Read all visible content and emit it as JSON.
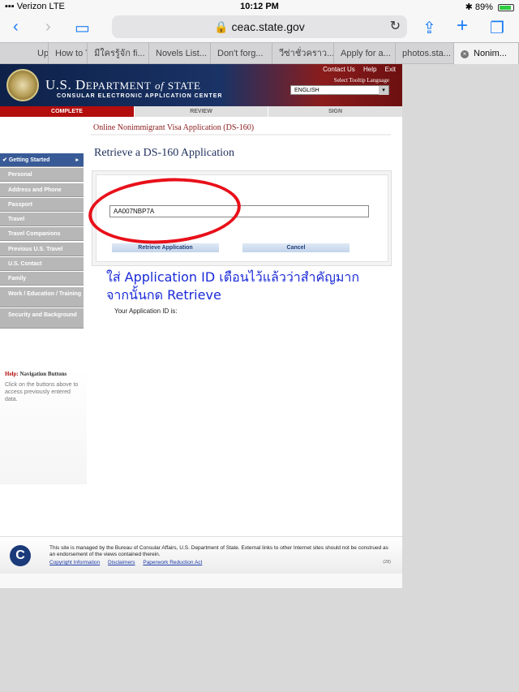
{
  "status_bar": {
    "carrier": "Verizon",
    "network": "LTE",
    "time": "10:12 PM",
    "battery": "89%",
    "battery_level": 0.89
  },
  "browser": {
    "url": "ceac.state.gov",
    "tabs": [
      "Up",
      "How to T",
      "มีใครรู้จัก fi...",
      "Novels List...",
      "Don't forg...",
      "วีซ่าชั่วคราว...",
      "Apply for a...",
      "photos.sta...",
      "Nonim..."
    ],
    "active_tab_index": 8
  },
  "header": {
    "title_us": "U.S. D",
    "title_rest": "EPARTMENT",
    "title_of": "of",
    "title_state": "STATE",
    "subtitle": "CONSULAR ELECTRONIC APPLICATION CENTER",
    "links": [
      "Contact Us",
      "Help",
      "Exit"
    ],
    "tooltip_label": "Select Tooltip Language",
    "language": "ENGLISH"
  },
  "progress": {
    "complete": "COMPLETE",
    "review": "REVIEW",
    "sign": "SIGN"
  },
  "app_title": "Online Nonimmigrant Visa Application (DS-160)",
  "page_title": "Retrieve a DS-160 Application",
  "sidebar": {
    "items": [
      "Getting Started",
      "Personal",
      "Address and Phone",
      "Passport",
      "Travel",
      "Travel Companions",
      "Previous U.S. Travel",
      "U.S. Contact",
      "Family",
      "Work / Education / Training",
      "Security and Background"
    ]
  },
  "help": {
    "label": "Help:",
    "title": "Navigation Buttons",
    "text": "Click on the buttons above to access previously entered data."
  },
  "form": {
    "id_label": "Your Application ID is:",
    "id_value": "AA007NBP7A",
    "retrieve_label": "Retrieve Application",
    "cancel_label": "Cancel"
  },
  "annotation": {
    "line1": "ใส่ Application ID เตือนไว้แล้วว่าสำคัญมาก",
    "line2": "จากนั้นกด Retrieve"
  },
  "footer": {
    "text": "This site is managed by the Bureau of Consular Affairs, U.S. Department of State. External links to other Internet sites should not be construed as an endorsement of the views contained therein.",
    "links": [
      "Copyright Information",
      "Disclaimers",
      "Paperwork Reduction Act"
    ],
    "version": "(28)",
    "logo_letter": "C"
  },
  "colors": {
    "accent_red": "#b30d0d",
    "nav_blue": "#385b97",
    "annotation_blue": "#1a2ad8",
    "circle_red": "#e8101a"
  }
}
